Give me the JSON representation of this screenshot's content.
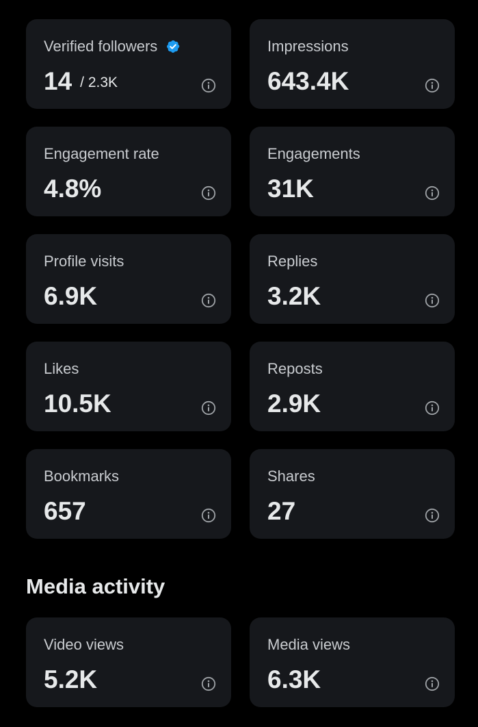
{
  "metrics": [
    {
      "label": "Verified followers",
      "value": "14",
      "suffix": "/ 2.3K"
    },
    {
      "label": "Impressions",
      "value": "643.4K"
    },
    {
      "label": "Engagement rate",
      "value": "4.8%"
    },
    {
      "label": "Engagements",
      "value": "31K"
    },
    {
      "label": "Profile visits",
      "value": "6.9K"
    },
    {
      "label": "Replies",
      "value": "3.2K"
    },
    {
      "label": "Likes",
      "value": "10.5K"
    },
    {
      "label": "Reposts",
      "value": "2.9K"
    },
    {
      "label": "Bookmarks",
      "value": "657"
    },
    {
      "label": "Shares",
      "value": "27"
    }
  ],
  "media_activity": {
    "title": "Media activity",
    "metrics": [
      {
        "label": "Video views",
        "value": "5.2K"
      },
      {
        "label": "Media views",
        "value": "6.3K"
      }
    ]
  },
  "icons": {
    "info": "info-circle-icon",
    "verified": "verified-badge-icon"
  },
  "colors": {
    "background": "#000000",
    "card": "#16181c",
    "verified_badge": "#1d9bf0",
    "text_primary": "#e7e9ea",
    "text_secondary": "#c9ccd0"
  }
}
